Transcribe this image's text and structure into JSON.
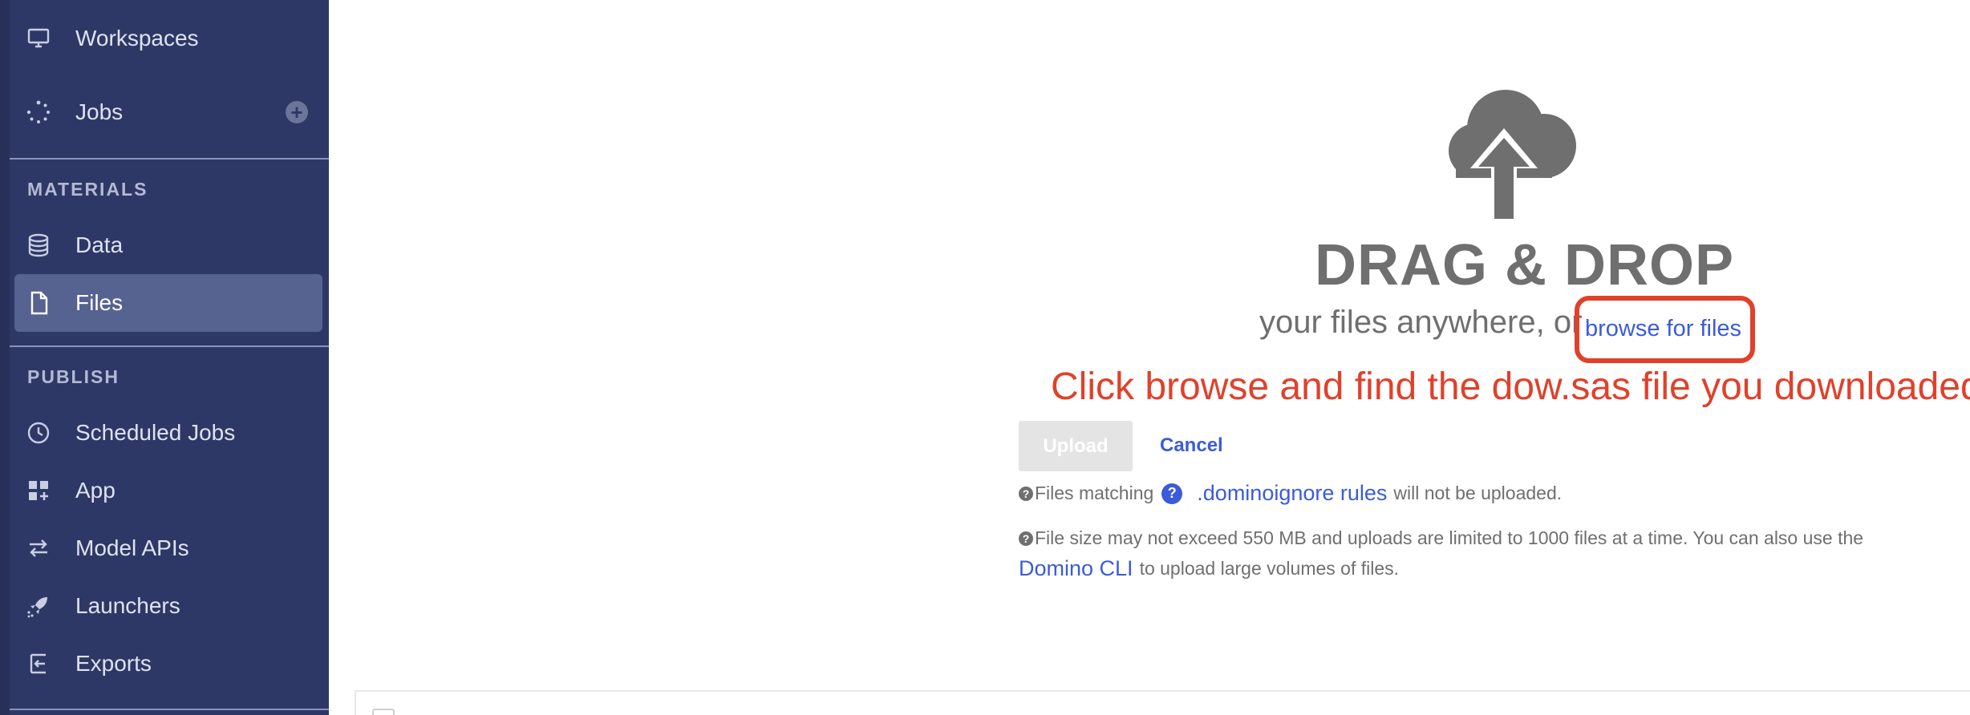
{
  "sidebar": {
    "items_top": [
      {
        "label": "Workspaces",
        "icon": "monitor-icon"
      },
      {
        "label": "Jobs",
        "icon": "spinner-icon",
        "action_icon": "plus-icon",
        "action_glyph": "+"
      }
    ],
    "sections": [
      {
        "label": "MATERIALS",
        "items": [
          {
            "label": "Data",
            "icon": "database-icon"
          },
          {
            "label": "Files",
            "icon": "file-icon",
            "active": true
          }
        ]
      },
      {
        "label": "PUBLISH",
        "items": [
          {
            "label": "Scheduled Jobs",
            "icon": "clock-icon"
          },
          {
            "label": "App",
            "icon": "app-grid-icon"
          },
          {
            "label": "Model APIs",
            "icon": "swap-arrows-icon"
          },
          {
            "label": "Launchers",
            "icon": "rocket-icon"
          },
          {
            "label": "Exports",
            "icon": "export-icon"
          }
        ]
      }
    ]
  },
  "dropzone": {
    "icon": "cloud-upload-icon",
    "title": "DRAG & DROP",
    "subtitle": "your files anywhere, or",
    "browse_label": "browse for files",
    "annotation": "Click browse and find the dow.sas file you downloaded",
    "upload_label": "Upload",
    "cancel_label": "Cancel",
    "ignore_prefix": "Files matching",
    "ignore_badge": "?",
    "ignore_link": ".dominoignore rules",
    "ignore_suffix": "will not be uploaded.",
    "size_note": "File size may not exceed 550 MB and uploads are limited to 1000 files at a time. You can also use the",
    "cli_link": "Domino CLI",
    "cli_suffix": "to upload large volumes of files.",
    "info_glyph": "?"
  },
  "colors": {
    "sidebar_bg": "#2d3866",
    "sidebar_active": "#56628f",
    "link": "#3b5bdb",
    "annotation": "#e0412b",
    "muted_text": "#6f6f6f"
  }
}
